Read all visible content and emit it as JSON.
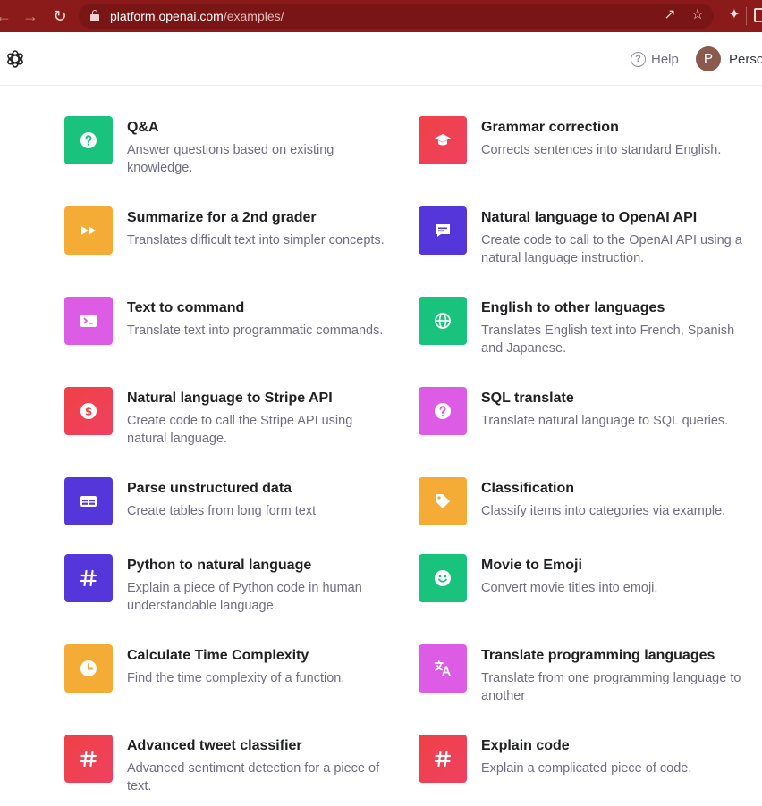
{
  "browser": {
    "url_host": "platform.openai.com",
    "url_path": "/examples/"
  },
  "header": {
    "help_label": "Help",
    "avatar_initial": "P",
    "account_name": "Perso"
  },
  "examples": [
    {
      "title": "Q&A",
      "description": "Answer questions based on existing knowledge.",
      "icon": "question-icon",
      "color": "#19c37d"
    },
    {
      "title": "Grammar correction",
      "description": "Corrects sentences into standard English.",
      "icon": "graduation-cap-icon",
      "color": "#ef4146"
    },
    {
      "title": "Summarize for a 2nd grader",
      "description": "Translates difficult text into simpler concepts.",
      "icon": "fast-forward-icon",
      "color": "#f4ac36"
    },
    {
      "title": "Natural language to OpenAI API",
      "description": "Create code to call to the OpenAI API using a natural language instruction.",
      "icon": "message-icon",
      "color": "#5436da"
    },
    {
      "title": "Text to command",
      "description": "Translate text into programmatic commands.",
      "icon": "terminal-icon",
      "color": "#dd5ce5"
    },
    {
      "title": "English to other languages",
      "description": "Translates English text into French, Spanish and Japanese.",
      "icon": "globe-icon",
      "color": "#19c37d"
    },
    {
      "title": "Natural language to Stripe API",
      "description": "Create code to call the Stripe API using natural language.",
      "icon": "dollar-icon",
      "color": "#ef4146"
    },
    {
      "title": "SQL translate",
      "description": "Translate natural language to SQL queries.",
      "icon": "question-icon",
      "color": "#dd5ce5"
    },
    {
      "title": "Parse unstructured data",
      "description": "Create tables from long form text",
      "icon": "table-icon",
      "color": "#5436da"
    },
    {
      "title": "Classification",
      "description": "Classify items into categories via example.",
      "icon": "tag-icon",
      "color": "#f4ac36"
    },
    {
      "title": "Python to natural language",
      "description": "Explain a piece of Python code in human understandable language.",
      "icon": "hash-icon",
      "color": "#5436da"
    },
    {
      "title": "Movie to Emoji",
      "description": "Convert movie titles into emoji.",
      "icon": "smiley-icon",
      "color": "#19c37d"
    },
    {
      "title": "Calculate Time Complexity",
      "description": "Find the time complexity of a function.",
      "icon": "clock-icon",
      "color": "#f4ac36"
    },
    {
      "title": "Translate programming languages",
      "description": "Translate from one programming language to another",
      "icon": "translate-icon",
      "color": "#dd5ce5"
    },
    {
      "title": "Advanced tweet classifier",
      "description": "Advanced sentiment detection for a piece of text.",
      "icon": "hash-icon",
      "color": "#ef4146"
    },
    {
      "title": "Explain code",
      "description": "Explain a complicated piece of code.",
      "icon": "hash-icon",
      "color": "#ef4146"
    }
  ]
}
